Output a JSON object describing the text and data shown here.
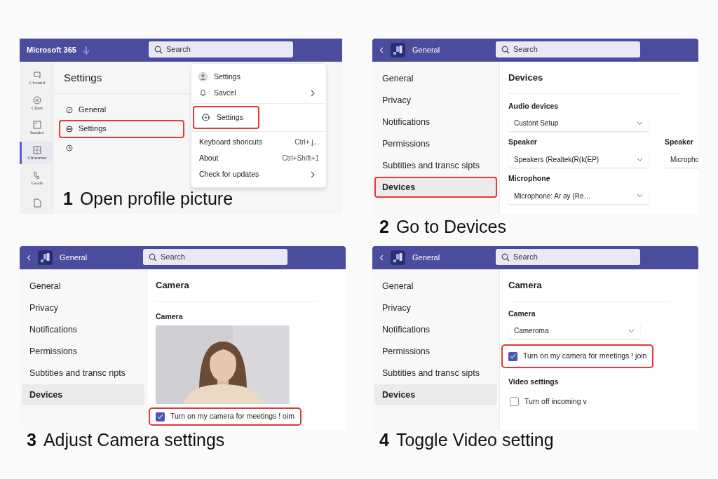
{
  "steps": [
    {
      "kind": "profile_menu",
      "caption": {
        "number": "1",
        "text": "Open profile picture"
      },
      "topbar": {
        "app": "Microsoft 365",
        "search": "Search"
      },
      "rail": [
        {
          "label": "Clrenntl",
          "selected": false
        },
        {
          "label": "Clpes",
          "selected": false
        },
        {
          "label": "Inxairo",
          "selected": false
        },
        {
          "label": "Chiusmar",
          "selected": true
        },
        {
          "label": "Goals",
          "selected": false
        },
        {
          "selected": false
        }
      ],
      "title": "Settings",
      "nav": [
        {
          "label": "General",
          "highlighted": false
        },
        {
          "label": "Settings",
          "highlighted": true
        },
        {
          "highlighted": false
        }
      ],
      "menu": [
        [
          {
            "kind": "profile",
            "label": "Settings",
            "highlighted": false,
            "submenu": false
          },
          {
            "kind": "notifications",
            "label": "Savcel",
            "highlighted": false,
            "submenu": true
          }
        ],
        [
          {
            "kind": "settings",
            "label": "Settings",
            "highlighted": true,
            "submenu": false
          }
        ],
        [
          {
            "kind": "plain",
            "label": "Keyboard shoricuts",
            "shortcut": "Ctrl+.j...",
            "highlighted": false,
            "submenu": false
          },
          {
            "kind": "plain",
            "label": "About",
            "shortcut": "Ctrl+Shift+1",
            "highlighted": false,
            "submenu": false
          },
          {
            "kind": "plain",
            "label": "Check for updates",
            "highlighted": false,
            "submenu": true
          }
        ]
      ]
    },
    {
      "kind": "settings",
      "caption": {
        "number": "2",
        "text": "Go to Devices"
      },
      "topbar": {
        "app": "General",
        "search": "Search"
      },
      "nav": [
        {
          "label": "General",
          "selected": false,
          "highlighted": false
        },
        {
          "label": "Privacy",
          "selected": false,
          "highlighted": false
        },
        {
          "label": "Notifications",
          "selected": false,
          "highlighted": false
        },
        {
          "label": "Permissions",
          "selected": false,
          "highlighted": false
        },
        {
          "label": "Subtities and transc sipts",
          "selected": false,
          "highlighted": false
        },
        {
          "label": "Devices",
          "selected": true,
          "highlighted": true
        }
      ],
      "title": "Devices",
      "controls": [
        {
          "kind": "field",
          "label": "Audio devices",
          "value": "Custont Setup"
        },
        {
          "kind": "field_row",
          "fields": [
            {
              "label": "Speaker",
              "value": "Speakers (Realtek(R(k(EP)"
            },
            {
              "label": "Speaker",
              "value": "Micropho"
            }
          ]
        },
        {
          "kind": "field",
          "label": "Microphone",
          "value": "Microphone: Ar ay (Re…"
        }
      ]
    },
    {
      "kind": "settings",
      "caption": {
        "number": "3",
        "text": "Adjust Camera settings"
      },
      "topbar": {
        "app": "General",
        "search": "Search"
      },
      "nav": [
        {
          "label": "General",
          "selected": false,
          "highlighted": false
        },
        {
          "label": "Privacy",
          "selected": false,
          "highlighted": false
        },
        {
          "label": "Notifications",
          "selected": false,
          "highlighted": false
        },
        {
          "label": "Permissions",
          "selected": false,
          "highlighted": false
        },
        {
          "label": "Subtities and transc ripts",
          "selected": false,
          "highlighted": false
        },
        {
          "label": "Devices",
          "selected": true,
          "highlighted": false
        }
      ],
      "title": "Camera",
      "controls": [
        {
          "kind": "label",
          "text": "Camera"
        },
        {
          "kind": "picture"
        },
        {
          "kind": "checkbox",
          "label": "Turn on my camera for meetings ! oim",
          "checked": true,
          "highlighted": true
        }
      ]
    },
    {
      "kind": "settings",
      "caption": {
        "number": "4",
        "text": "Toggle Video setting"
      },
      "topbar": {
        "app": "General",
        "search": "Search"
      },
      "nav": [
        {
          "label": "General",
          "selected": false,
          "highlighted": false
        },
        {
          "label": "Privacy",
          "selected": false,
          "highlighted": false
        },
        {
          "label": "Notifications",
          "selected": false,
          "highlighted": false
        },
        {
          "label": "Permissions",
          "selected": false,
          "highlighted": false
        },
        {
          "label": "Subtities and transc sipts",
          "selected": false,
          "highlighted": false
        },
        {
          "label": "Devices",
          "selected": true,
          "highlighted": false
        }
      ],
      "title": "Camera",
      "controls": [
        {
          "kind": "field",
          "label": "Camera",
          "value": "Cameroma"
        },
        {
          "kind": "checkbox",
          "label": "Turn on my camera for meetings ! join",
          "checked": true,
          "highlighted": true
        },
        {
          "kind": "label",
          "text": "Video settings"
        },
        {
          "kind": "checkbox",
          "label": "Turn off incoming v",
          "checked": false,
          "highlighted": false
        }
      ]
    }
  ]
}
